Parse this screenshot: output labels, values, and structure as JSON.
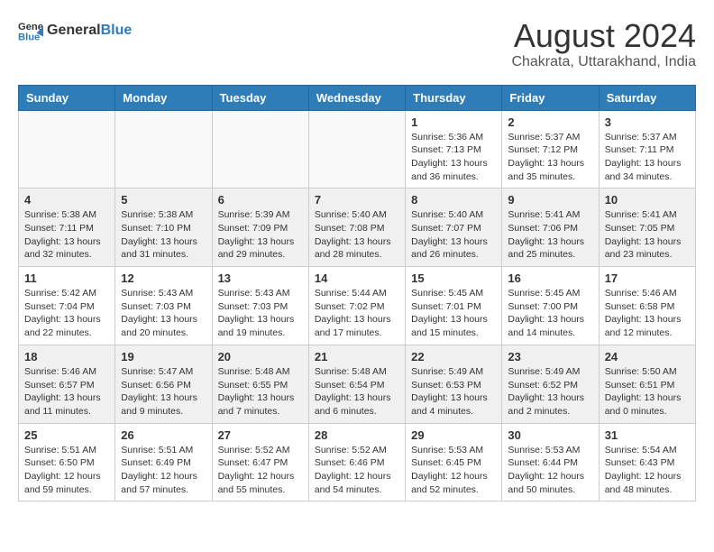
{
  "header": {
    "logo_general": "General",
    "logo_blue": "Blue",
    "main_title": "August 2024",
    "subtitle": "Chakrata, Uttarakhand, India"
  },
  "calendar": {
    "days_of_week": [
      "Sunday",
      "Monday",
      "Tuesday",
      "Wednesday",
      "Thursday",
      "Friday",
      "Saturday"
    ],
    "weeks": [
      [
        {
          "day": "",
          "info": ""
        },
        {
          "day": "",
          "info": ""
        },
        {
          "day": "",
          "info": ""
        },
        {
          "day": "",
          "info": ""
        },
        {
          "day": "1",
          "info": "Sunrise: 5:36 AM\nSunset: 7:13 PM\nDaylight: 13 hours\nand 36 minutes."
        },
        {
          "day": "2",
          "info": "Sunrise: 5:37 AM\nSunset: 7:12 PM\nDaylight: 13 hours\nand 35 minutes."
        },
        {
          "day": "3",
          "info": "Sunrise: 5:37 AM\nSunset: 7:11 PM\nDaylight: 13 hours\nand 34 minutes."
        }
      ],
      [
        {
          "day": "4",
          "info": "Sunrise: 5:38 AM\nSunset: 7:11 PM\nDaylight: 13 hours\nand 32 minutes."
        },
        {
          "day": "5",
          "info": "Sunrise: 5:38 AM\nSunset: 7:10 PM\nDaylight: 13 hours\nand 31 minutes."
        },
        {
          "day": "6",
          "info": "Sunrise: 5:39 AM\nSunset: 7:09 PM\nDaylight: 13 hours\nand 29 minutes."
        },
        {
          "day": "7",
          "info": "Sunrise: 5:40 AM\nSunset: 7:08 PM\nDaylight: 13 hours\nand 28 minutes."
        },
        {
          "day": "8",
          "info": "Sunrise: 5:40 AM\nSunset: 7:07 PM\nDaylight: 13 hours\nand 26 minutes."
        },
        {
          "day": "9",
          "info": "Sunrise: 5:41 AM\nSunset: 7:06 PM\nDaylight: 13 hours\nand 25 minutes."
        },
        {
          "day": "10",
          "info": "Sunrise: 5:41 AM\nSunset: 7:05 PM\nDaylight: 13 hours\nand 23 minutes."
        }
      ],
      [
        {
          "day": "11",
          "info": "Sunrise: 5:42 AM\nSunset: 7:04 PM\nDaylight: 13 hours\nand 22 minutes."
        },
        {
          "day": "12",
          "info": "Sunrise: 5:43 AM\nSunset: 7:03 PM\nDaylight: 13 hours\nand 20 minutes."
        },
        {
          "day": "13",
          "info": "Sunrise: 5:43 AM\nSunset: 7:03 PM\nDaylight: 13 hours\nand 19 minutes."
        },
        {
          "day": "14",
          "info": "Sunrise: 5:44 AM\nSunset: 7:02 PM\nDaylight: 13 hours\nand 17 minutes."
        },
        {
          "day": "15",
          "info": "Sunrise: 5:45 AM\nSunset: 7:01 PM\nDaylight: 13 hours\nand 15 minutes."
        },
        {
          "day": "16",
          "info": "Sunrise: 5:45 AM\nSunset: 7:00 PM\nDaylight: 13 hours\nand 14 minutes."
        },
        {
          "day": "17",
          "info": "Sunrise: 5:46 AM\nSunset: 6:58 PM\nDaylight: 13 hours\nand 12 minutes."
        }
      ],
      [
        {
          "day": "18",
          "info": "Sunrise: 5:46 AM\nSunset: 6:57 PM\nDaylight: 13 hours\nand 11 minutes."
        },
        {
          "day": "19",
          "info": "Sunrise: 5:47 AM\nSunset: 6:56 PM\nDaylight: 13 hours\nand 9 minutes."
        },
        {
          "day": "20",
          "info": "Sunrise: 5:48 AM\nSunset: 6:55 PM\nDaylight: 13 hours\nand 7 minutes."
        },
        {
          "day": "21",
          "info": "Sunrise: 5:48 AM\nSunset: 6:54 PM\nDaylight: 13 hours\nand 6 minutes."
        },
        {
          "day": "22",
          "info": "Sunrise: 5:49 AM\nSunset: 6:53 PM\nDaylight: 13 hours\nand 4 minutes."
        },
        {
          "day": "23",
          "info": "Sunrise: 5:49 AM\nSunset: 6:52 PM\nDaylight: 13 hours\nand 2 minutes."
        },
        {
          "day": "24",
          "info": "Sunrise: 5:50 AM\nSunset: 6:51 PM\nDaylight: 13 hours\nand 0 minutes."
        }
      ],
      [
        {
          "day": "25",
          "info": "Sunrise: 5:51 AM\nSunset: 6:50 PM\nDaylight: 12 hours\nand 59 minutes."
        },
        {
          "day": "26",
          "info": "Sunrise: 5:51 AM\nSunset: 6:49 PM\nDaylight: 12 hours\nand 57 minutes."
        },
        {
          "day": "27",
          "info": "Sunrise: 5:52 AM\nSunset: 6:47 PM\nDaylight: 12 hours\nand 55 minutes."
        },
        {
          "day": "28",
          "info": "Sunrise: 5:52 AM\nSunset: 6:46 PM\nDaylight: 12 hours\nand 54 minutes."
        },
        {
          "day": "29",
          "info": "Sunrise: 5:53 AM\nSunset: 6:45 PM\nDaylight: 12 hours\nand 52 minutes."
        },
        {
          "day": "30",
          "info": "Sunrise: 5:53 AM\nSunset: 6:44 PM\nDaylight: 12 hours\nand 50 minutes."
        },
        {
          "day": "31",
          "info": "Sunrise: 5:54 AM\nSunset: 6:43 PM\nDaylight: 12 hours\nand 48 minutes."
        }
      ]
    ]
  }
}
